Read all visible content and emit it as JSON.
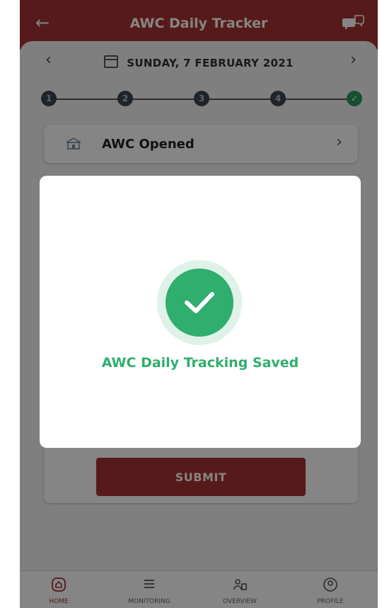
{
  "header": {
    "title": "AWC Daily Tracker",
    "back_icon": "arrow-left-icon",
    "chat_icon": "chat-bubbles-icon"
  },
  "date_nav": {
    "date": "SUNDAY, 7 FEBRUARY 2021",
    "prev_icon": "chevron-left-icon",
    "next_icon": "chevron-right-icon",
    "calendar_icon": "calendar-icon"
  },
  "stepper": {
    "steps": [
      "1",
      "2",
      "3",
      "4",
      "✓"
    ],
    "completed_color": "#2c9a5e"
  },
  "status_card": {
    "label": "AWC Opened",
    "icon": "building-icon"
  },
  "form": {
    "submit_label": "SUBMIT"
  },
  "dialog": {
    "message": "AWC Daily Tracking Saved",
    "icon": "check-circle-icon",
    "accent_color": "#2fae6e"
  },
  "bottom_nav": {
    "items": [
      {
        "label": "HOME",
        "icon": "home-icon"
      },
      {
        "label": "MONITORING",
        "icon": "list-icon"
      },
      {
        "label": "OVERVIEW",
        "icon": "people-icon"
      },
      {
        "label": "PROFILE",
        "icon": "profile-icon"
      }
    ]
  },
  "colors": {
    "brand": "#a83232",
    "success": "#2fae6e"
  }
}
